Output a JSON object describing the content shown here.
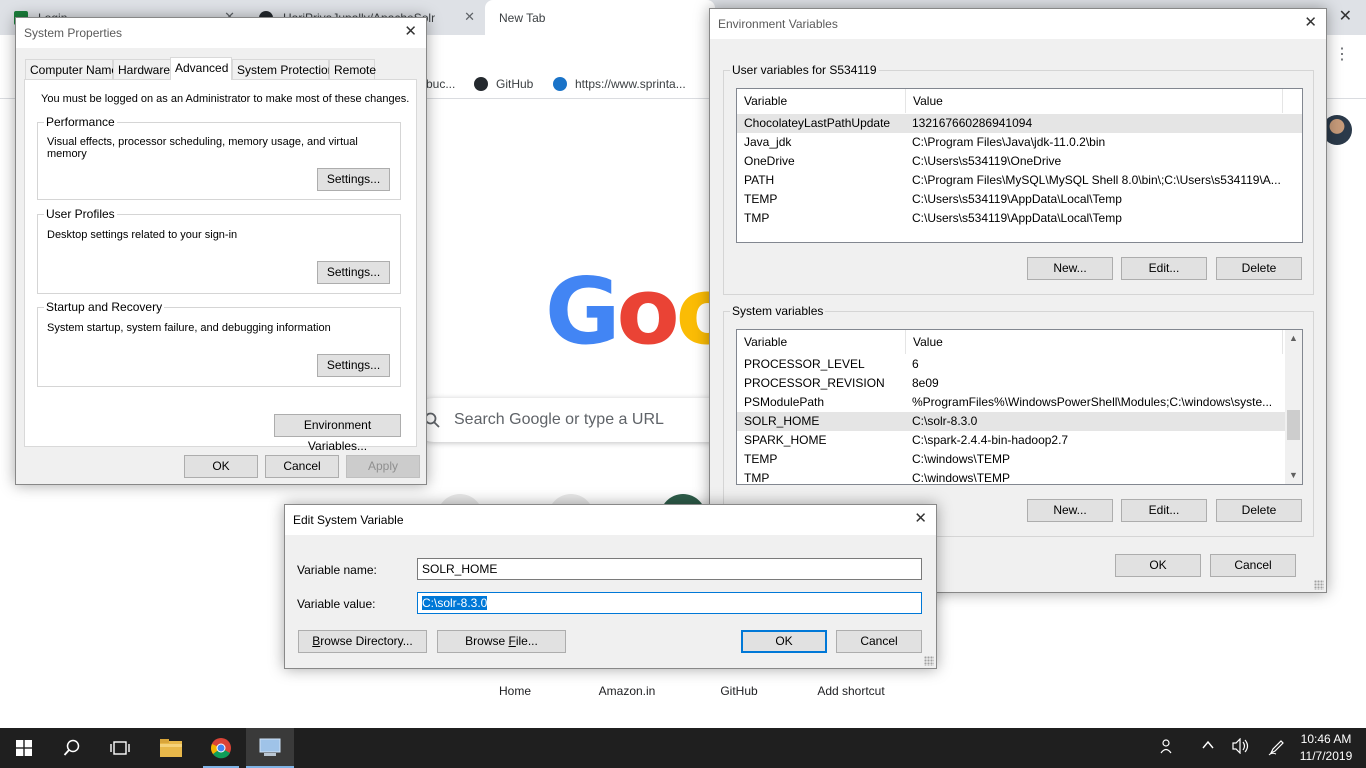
{
  "browser": {
    "tabs": [
      {
        "title": "Login"
      },
      {
        "title": "HariPriyaJupally/ApacheSolr"
      },
      {
        "title": "New Tab"
      }
    ],
    "close_glyph": "✕",
    "bookmarks": [
      {
        "label": "buc..."
      },
      {
        "label": "GitHub"
      },
      {
        "label": "https://www.sprinta..."
      }
    ],
    "search_placeholder": "Search Google or type a URL",
    "logo_text": [
      "G",
      "o",
      "o"
    ],
    "shortcuts": [
      {
        "label": "Home"
      },
      {
        "label": "Amazon.in"
      },
      {
        "label": "GitHub"
      },
      {
        "label": "Add shortcut"
      }
    ]
  },
  "system_properties": {
    "title": "System Properties",
    "tabs": [
      "Computer Name",
      "Hardware",
      "Advanced",
      "System Protection",
      "Remote"
    ],
    "selected_tab": "Advanced",
    "admin_note": "You must be logged on as an Administrator to make most of these changes.",
    "groups": [
      {
        "title": "Performance",
        "desc": "Visual effects, processor scheduling, memory usage, and virtual memory",
        "button": "Settings..."
      },
      {
        "title": "User Profiles",
        "desc": "Desktop settings related to your sign-in",
        "button": "Settings..."
      },
      {
        "title": "Startup and Recovery",
        "desc": "System startup, system failure, and debugging information",
        "button": "Settings..."
      }
    ],
    "env_button": "Environment Variables...",
    "ok": "OK",
    "cancel": "Cancel",
    "apply": "Apply"
  },
  "environment_variables": {
    "title": "Environment Variables",
    "user_section_title": "User variables for S534119",
    "columns": [
      "Variable",
      "Value"
    ],
    "user_rows": [
      {
        "variable": "ChocolateyLastPathUpdate",
        "value": "132167660286941094"
      },
      {
        "variable": "Java_jdk",
        "value": "C:\\Program Files\\Java\\jdk-11.0.2\\bin"
      },
      {
        "variable": "OneDrive",
        "value": "C:\\Users\\s534119\\OneDrive"
      },
      {
        "variable": "PATH",
        "value": "C:\\Program Files\\MySQL\\MySQL Shell 8.0\\bin\\;C:\\Users\\s534119\\A..."
      },
      {
        "variable": "TEMP",
        "value": "C:\\Users\\s534119\\AppData\\Local\\Temp"
      },
      {
        "variable": "TMP",
        "value": "C:\\Users\\s534119\\AppData\\Local\\Temp"
      }
    ],
    "system_section_title": "System variables",
    "system_rows": [
      {
        "variable": "PROCESSOR_LEVEL",
        "value": "6"
      },
      {
        "variable": "PROCESSOR_REVISION",
        "value": "8e09"
      },
      {
        "variable": "PSModulePath",
        "value": "%ProgramFiles%\\WindowsPowerShell\\Modules;C:\\windows\\syste..."
      },
      {
        "variable": "SOLR_HOME",
        "value": "C:\\solr-8.3.0"
      },
      {
        "variable": "SPARK_HOME",
        "value": "C:\\spark-2.4.4-bin-hadoop2.7"
      },
      {
        "variable": "TEMP",
        "value": "C:\\windows\\TEMP"
      },
      {
        "variable": "TMP",
        "value": "C:\\windows\\TEMP"
      }
    ],
    "new_button": "New...",
    "edit_button": "Edit...",
    "delete_button": "Delete",
    "ok": "OK",
    "cancel": "Cancel"
  },
  "edit_variable": {
    "title": "Edit System Variable",
    "name_label": "Variable name:",
    "name_value": "SOLR_HOME",
    "value_label": "Variable value:",
    "value_value": "C:\\solr-8.3.0",
    "browse_dir": "Browse Directory...",
    "browse_file": "Browse File...",
    "ok": "OK",
    "cancel": "Cancel"
  },
  "taskbar": {
    "time": "10:46 AM",
    "date": "11/7/2019",
    "icons": [
      "windows-start-icon",
      "search-icon",
      "task-view-icon",
      "file-explorer-icon",
      "chrome-icon",
      "system-properties-icon"
    ]
  },
  "colors": {
    "accent": "#0078d7",
    "taskbar": "#1f1f1f",
    "dialog_bg": "#f0f0f0"
  }
}
